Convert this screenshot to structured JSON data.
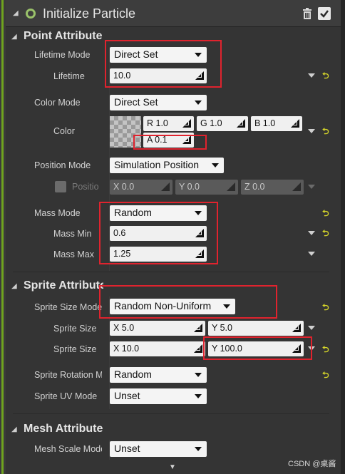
{
  "header": {
    "title": "Initialize Particle"
  },
  "sections": {
    "point": {
      "label": "Point Attribute"
    },
    "sprite": {
      "label": "Sprite Attribute"
    },
    "mesh": {
      "label": "Mesh Attribute"
    }
  },
  "point": {
    "lifetime_mode_label": "Lifetime Mode",
    "lifetime_mode_value": "Direct Set",
    "lifetime_label": "Lifetime",
    "lifetime_value": "10.0",
    "color_mode_label": "Color Mode",
    "color_mode_value": "Direct Set",
    "color_label": "Color",
    "color_r": "R 1.0",
    "color_g": "G 1.0",
    "color_b": "B 1.0",
    "color_a": "A 0.1",
    "position_mode_label": "Position Mode",
    "position_mode_value": "Simulation Position",
    "position_label": "Positio",
    "position_x": "X 0.0",
    "position_y": "Y 0.0",
    "position_z": "Z 0.0",
    "mass_mode_label": "Mass Mode",
    "mass_mode_value": "Random",
    "mass_min_label": "Mass Min",
    "mass_min_value": "0.6",
    "mass_max_label": "Mass Max",
    "mass_max_value": "1.25"
  },
  "sprite": {
    "size_mode_label": "Sprite Size Mode",
    "size_mode_value": "Random Non-Uniform",
    "size1_label": "Sprite Size",
    "size1_x": "X 5.0",
    "size1_y": "Y 5.0",
    "size2_label": "Sprite Size",
    "size2_x": "X 10.0",
    "size2_y": "Y 100.0",
    "rotation_label": "Sprite Rotation Mode",
    "rotation_value": "Random",
    "uv_label": "Sprite UV Mode",
    "uv_value": "Unset"
  },
  "mesh": {
    "scale_label": "Mesh Scale Mode",
    "scale_value": "Unset"
  },
  "watermark": "CSDN @桌酱",
  "colors": {
    "accent_green": "#6fa31f",
    "highlight_red": "#e0232e",
    "reset_yellow": "#d6d62a"
  }
}
